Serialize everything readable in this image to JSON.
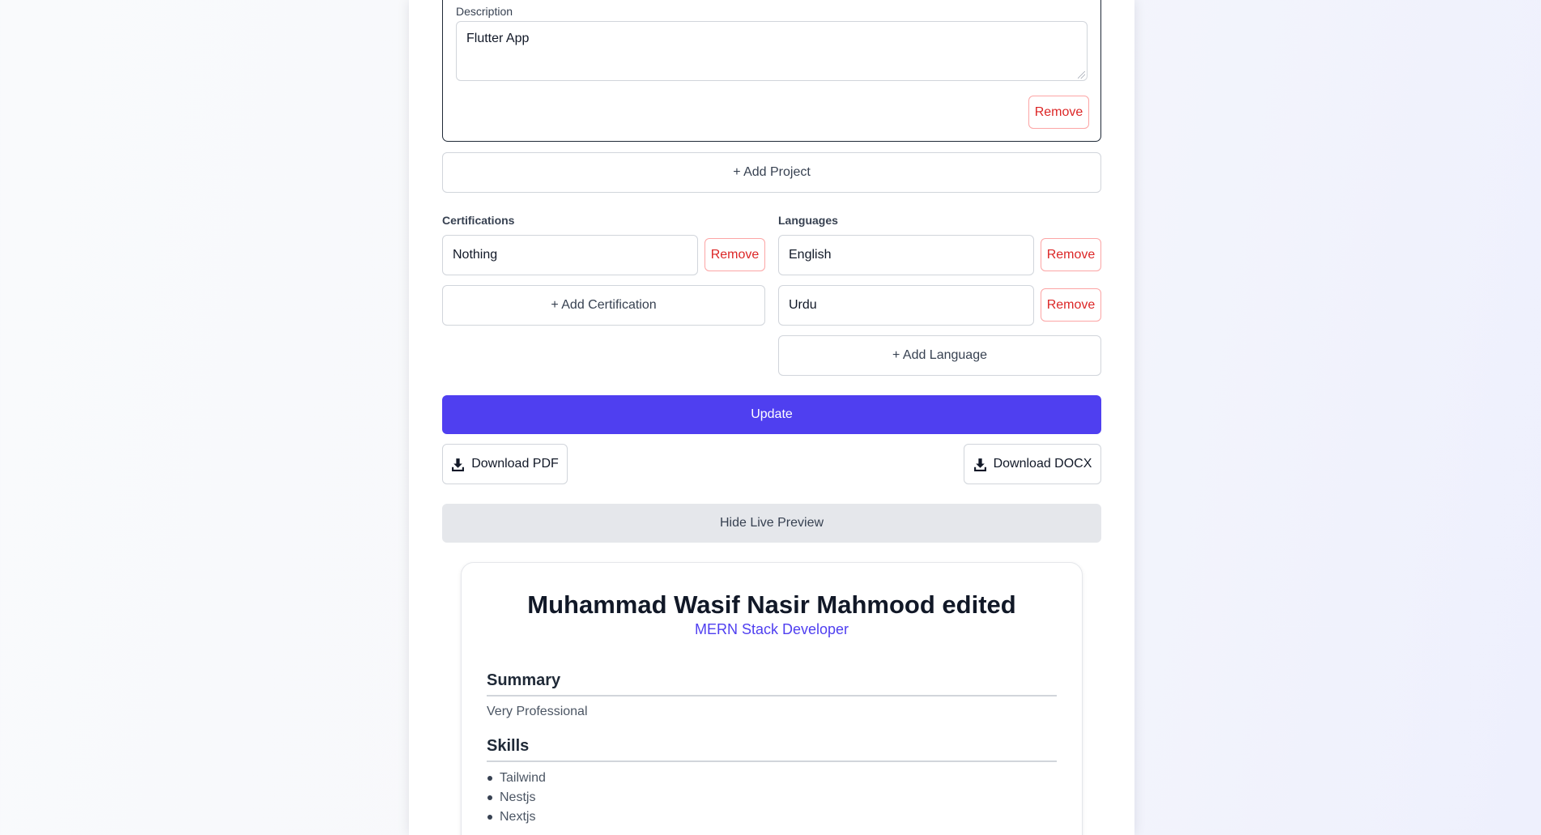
{
  "project": {
    "description_label": "Description",
    "description_value": "Flutter App",
    "remove_label": "Remove",
    "add_project_label": "+ Add Project"
  },
  "certifications": {
    "label": "Certifications",
    "items": [
      {
        "value": "Nothing",
        "remove_label": "Remove"
      }
    ],
    "add_label": "+ Add Certification"
  },
  "languages": {
    "label": "Languages",
    "items": [
      {
        "value": "English",
        "remove_label": "Remove"
      },
      {
        "value": "Urdu",
        "remove_label": "Remove"
      }
    ],
    "add_label": "+ Add Language"
  },
  "actions": {
    "update_label": "Update",
    "download_pdf_label": "Download PDF",
    "download_docx_label": "Download DOCX",
    "toggle_preview_label": "Hide Live Preview"
  },
  "preview": {
    "name": "Muhammad Wasif Nasir Mahmood edited",
    "title": "MERN Stack Developer",
    "summary_heading": "Summary",
    "summary_text": "Very Professional",
    "skills_heading": "Skills",
    "skills": [
      "Tailwind",
      "Nestjs",
      "Nextjs"
    ]
  },
  "colors": {
    "accent": "#4f3ff0",
    "danger": "#dc2626",
    "danger_border": "#fca5a5",
    "border": "#d1d5db",
    "muted_button": "#e5e7eb"
  },
  "icons": {
    "download": "download-icon"
  }
}
